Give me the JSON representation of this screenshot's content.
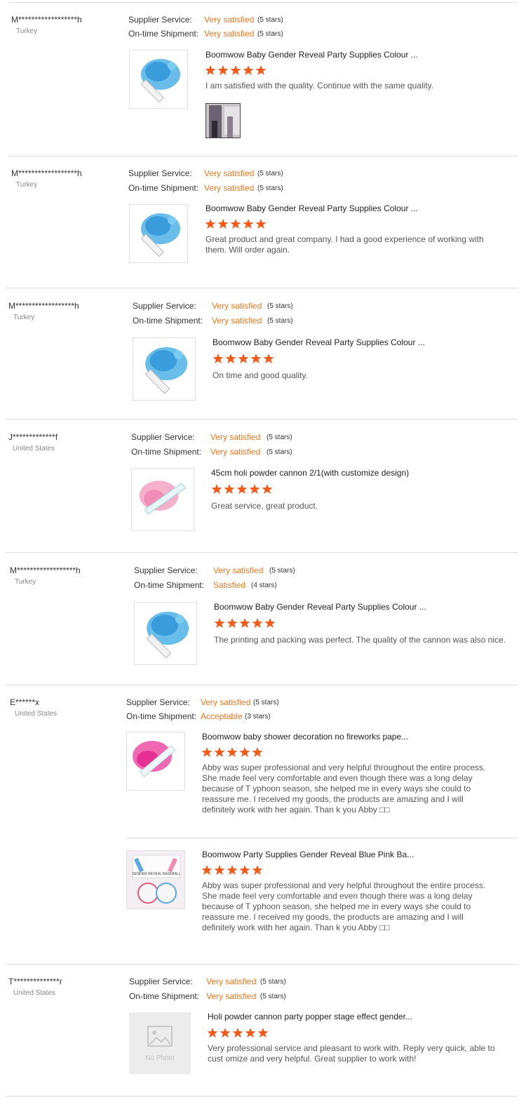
{
  "labels": {
    "supplier_service": "Supplier Service:",
    "ontime_shipment": "On-time Shipment:"
  },
  "colors": {
    "accent": "#f0761e",
    "star": "#f05a1a"
  },
  "reviews": [
    {
      "buyer": "M******************h",
      "country": "Turkey",
      "supplier_value": "Very satisfied",
      "supplier_stars": "(5 stars)",
      "shipment_value": "Very satisfied",
      "shipment_stars": "(5 stars)",
      "items": [
        {
          "title": "Boomwow Baby Gender Reveal Party Supplies Colour ...",
          "rating": 5,
          "text": "I am satisfied with the quality. Continue with the same quality.",
          "image": "blue-cannon-image",
          "has_attachment": true
        }
      ]
    },
    {
      "buyer": "M******************h",
      "country": "Turkey",
      "supplier_value": "Very satisfied",
      "supplier_stars": "(5 stars)",
      "shipment_value": "Very satisfied",
      "shipment_stars": "(5 stars)",
      "items": [
        {
          "title": "Boomwow Baby Gender Reveal Party Supplies Colour ...",
          "rating": 5,
          "text": "Great product and great company. I had a good experience of working with them. Will order again.",
          "image": "blue-cannon-image"
        }
      ]
    },
    {
      "buyer": "M******************h",
      "country": "Turkey",
      "supplier_value": "Very satisfied",
      "supplier_stars": "(5 stars)",
      "shipment_value": "Very satisfied",
      "shipment_stars": "(5 stars)",
      "items": [
        {
          "title": "Boomwow Baby Gender Reveal Party Supplies Colour ...",
          "rating": 5,
          "text": "On time and good quality.",
          "image": "blue-cannon-image"
        }
      ]
    },
    {
      "buyer": "J*************f",
      "country": "United States",
      "supplier_value": "Very satisfied",
      "supplier_stars": "(5 stars)",
      "shipment_value": "Very satisfied",
      "shipment_stars": "(5 stars)",
      "items": [
        {
          "title": "45cm holi powder cannon 2/1(with customize design)",
          "rating": 5,
          "text": "Great service, great product.",
          "image": "pink-cannon-image"
        }
      ]
    },
    {
      "buyer": "M******************h",
      "country": "Turkey",
      "supplier_value": "Very satisfied",
      "supplier_stars": "(5 stars)",
      "shipment_value": "Satisfied",
      "shipment_stars": "(4 stars)",
      "items": [
        {
          "title": "Boomwow Baby Gender Reveal Party Supplies Colour ...",
          "rating": 5,
          "text": "The printing and packing was perfect. The quality of the cannon was also nice.",
          "image": "blue-cannon-image"
        }
      ]
    },
    {
      "buyer": "E******x",
      "country": "United States",
      "supplier_value": "Very satisfied",
      "supplier_stars": "(5 stars)",
      "shipment_value": "Acceptable",
      "shipment_stars": "(3 stars)",
      "items": [
        {
          "title": "Boomwow baby shower decoration no fireworks pape...",
          "rating": 5,
          "text": "Abby was super professional and very helpful throughout the entire process. She made feel very comfortable and even though there was a long delay because of T yphoon season, she helped me in every ways she could to reassure me. I received my goods, the products are amazing and I will definitely work with her again. Than k you Abby □□",
          "image": "magenta-cannon-image"
        },
        {
          "title": "Boomwow Party Supplies Gender Reveal Blue Pink Ba...",
          "rating": 5,
          "text": "Abby was super professional and very helpful throughout the entire process. She made feel very comfortable and even though there was a long delay because of T yphoon season, she helped me in every ways she could to reassure me. I received my goods, the products are amazing and I will definitely work with her again. Than k you Abby □□",
          "image": "baseball-box-image",
          "image_caption": "GENDER REVEAL BASEBALL"
        }
      ]
    },
    {
      "buyer": "T**************r",
      "country": "United States",
      "supplier_value": "Very satisfied",
      "supplier_stars": "(5 stars)",
      "shipment_value": "Very satisfied",
      "shipment_stars": "(5 stars)",
      "items": [
        {
          "title": "Holi powder cannon party popper stage effect gender...",
          "rating": 5,
          "text": "Very professional service and pleasant to work with. Reply very quick, able to cust omize and very helpful. Great supplier to work with!",
          "image": "no-photo-image",
          "image_caption": "No Photo"
        }
      ]
    }
  ]
}
